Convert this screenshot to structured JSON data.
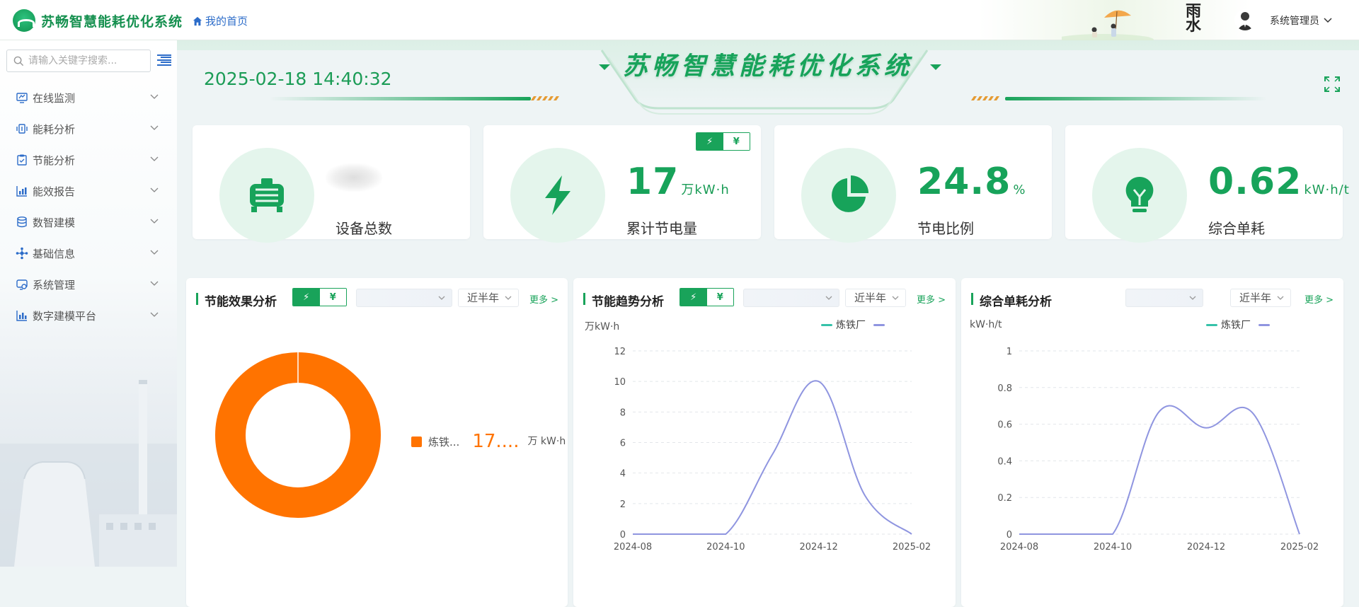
{
  "header": {
    "app_title": "苏畅智慧能耗优化系统",
    "home_link": "我的首页",
    "calligraphy": "雨 水",
    "username": "系统管理员"
  },
  "sidebar": {
    "search_placeholder": "请输入关键字搜索...",
    "items": [
      {
        "label": "在线监测",
        "icon": "monitor-icon"
      },
      {
        "label": "能耗分析",
        "icon": "energy-icon"
      },
      {
        "label": "节能分析",
        "icon": "clipboard-icon"
      },
      {
        "label": "能效报告",
        "icon": "report-chart-icon"
      },
      {
        "label": "数智建模",
        "icon": "database-icon"
      },
      {
        "label": "基础信息",
        "icon": "network-icon"
      },
      {
        "label": "系统管理",
        "icon": "settings-monitor-icon"
      },
      {
        "label": "数字建模平台",
        "icon": "platform-chart-icon"
      }
    ]
  },
  "banner": {
    "datetime": "2025-02-18 14:40:32",
    "title": "苏畅智慧能耗优化系统"
  },
  "stats": [
    {
      "label": "设备总数",
      "value": "",
      "unit": "",
      "icon": "motor-icon"
    },
    {
      "label": "累计节电量",
      "value": "17",
      "unit": "万kW·h",
      "icon": "lightning-icon"
    },
    {
      "label": "节电比例",
      "value": "24.8",
      "unit": "%",
      "icon": "pie-icon"
    },
    {
      "label": "综合单耗",
      "value": "0.62",
      "unit": "kW·h/t",
      "icon": "bulb-icon"
    }
  ],
  "toggle": {
    "electric": "⚡",
    "money": "¥"
  },
  "panels": {
    "effect": {
      "title": "节能效果分析",
      "period": "近半年",
      "more": "更多 >",
      "legend_name": "炼铁...",
      "legend_value": "17....",
      "legend_unit": "万 kW·h"
    },
    "trend": {
      "title": "节能趋势分析",
      "period": "近半年",
      "more": "更多 >",
      "unit": "万kW·h",
      "legend": "炼铁厂"
    },
    "unit_consumption": {
      "title": "综合单耗分析",
      "period": "近半年",
      "more": "更多 >",
      "unit": "kW·h/t",
      "legend": "炼铁厂"
    }
  },
  "chart_data": [
    {
      "type": "pie",
      "title": "节能效果分析",
      "slices": [
        {
          "name": "炼铁...",
          "value": 17
        }
      ],
      "colors": [
        "#ff7300"
      ],
      "legend_position": "right"
    },
    {
      "type": "line",
      "title": "节能趋势分析",
      "ylabel": "万kW·h",
      "x": [
        "2024-08",
        "2024-09",
        "2024-10",
        "2024-11",
        "2024-12",
        "2025-01",
        "2025-02"
      ],
      "x_ticks": [
        "2024-08",
        "2024-10",
        "2024-12",
        "2025-02"
      ],
      "series": [
        {
          "name": "炼铁厂",
          "values": [
            0,
            0,
            0,
            5.2,
            10,
            2.5,
            0
          ],
          "color": "#8f95e0"
        }
      ],
      "ylim": [
        0,
        12
      ],
      "y_ticks": [
        0,
        2,
        4,
        6,
        8,
        10,
        12
      ],
      "grid": true,
      "legend_position": "top-right"
    },
    {
      "type": "line",
      "title": "综合单耗分析",
      "ylabel": "kW·h/t",
      "x": [
        "2024-08",
        "2024-09",
        "2024-10",
        "2024-11",
        "2024-12",
        "2025-01",
        "2025-02"
      ],
      "x_ticks": [
        "2024-08",
        "2024-10",
        "2024-12",
        "2025-02"
      ],
      "series": [
        {
          "name": "炼铁厂",
          "values": [
            0,
            0,
            0,
            0.67,
            0.58,
            0.66,
            0
          ],
          "color": "#8f95e0"
        }
      ],
      "ylim": [
        0,
        1
      ],
      "y_ticks": [
        0,
        0.2,
        0.4,
        0.6,
        0.8,
        1
      ],
      "grid": true,
      "legend_position": "top-right"
    }
  ],
  "colors": {
    "brand_green": "#17a35a",
    "accent_orange": "#ff7300",
    "line_purple": "#8f95e0",
    "legend_teal": "#36c2a9"
  }
}
